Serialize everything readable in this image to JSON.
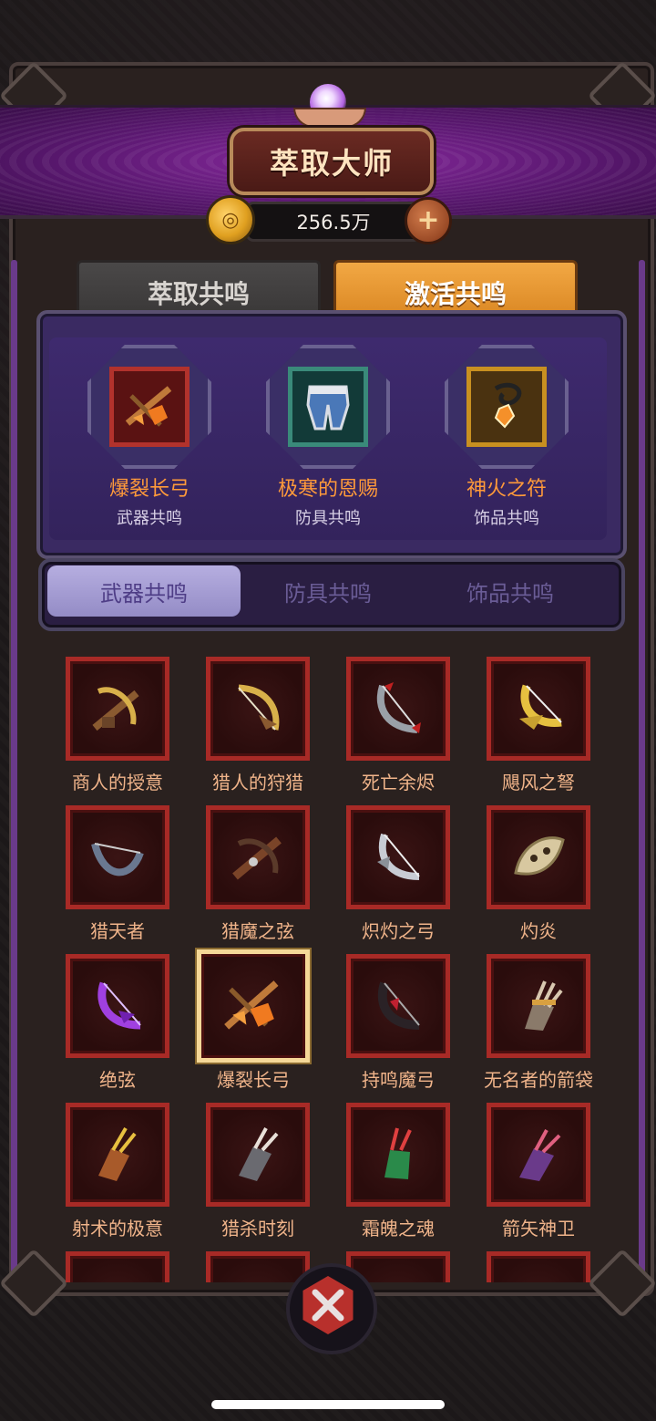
{
  "header": {
    "title": "萃取大师",
    "currency_amount": "256.5万",
    "coin_icon": "gold-coin-icon",
    "add_icon": "plus-icon"
  },
  "main_tabs": [
    {
      "label": "萃取共鸣",
      "active": false
    },
    {
      "label": "激活共鸣",
      "active": true
    }
  ],
  "resonance": [
    {
      "name": "爆裂长弓",
      "type": "武器共鸣",
      "icon": "crossbow-icon",
      "frame": "red"
    },
    {
      "name": "极寒的恩赐",
      "type": "防具共鸣",
      "icon": "pants-icon",
      "frame": "teal"
    },
    {
      "name": "神火之符",
      "type": "饰品共鸣",
      "icon": "amulet-icon",
      "frame": "gold"
    }
  ],
  "sub_tabs": [
    {
      "label": "武器共鸣",
      "active": true
    },
    {
      "label": "防具共鸣",
      "active": false
    },
    {
      "label": "饰品共鸣",
      "active": false
    }
  ],
  "items": [
    {
      "name": "商人的授意",
      "icon": "crossbow-icon"
    },
    {
      "name": "猎人的狩猎",
      "icon": "bow-icon"
    },
    {
      "name": "死亡余烬",
      "icon": "bow-icon"
    },
    {
      "name": "飓风之弩",
      "icon": "bow-icon"
    },
    {
      "name": "猎天者",
      "icon": "bow-icon"
    },
    {
      "name": "猎魔之弦",
      "icon": "crossbow-icon"
    },
    {
      "name": "炽灼之弓",
      "icon": "bow-icon"
    },
    {
      "name": "灼炎",
      "icon": "bow-icon"
    },
    {
      "name": "绝弦",
      "icon": "bow-icon"
    },
    {
      "name": "爆裂长弓",
      "icon": "crossbow-icon",
      "selected": true
    },
    {
      "name": "持鸣魔弓",
      "icon": "bow-icon"
    },
    {
      "name": "无名者的箭袋",
      "icon": "quiver-icon"
    },
    {
      "name": "射术的极意",
      "icon": "quiver-icon"
    },
    {
      "name": "猎杀时刻",
      "icon": "quiver-icon"
    },
    {
      "name": "霜魄之魂",
      "icon": "quiver-icon"
    },
    {
      "name": "箭矢神卫",
      "icon": "quiver-icon"
    }
  ],
  "close_icon": "close-icon",
  "colors": {
    "accent_orange": "#ff9a3a",
    "frame_red": "#a82a26",
    "tab_active": "#e89a34",
    "panel_purple": "#3a2a62"
  }
}
